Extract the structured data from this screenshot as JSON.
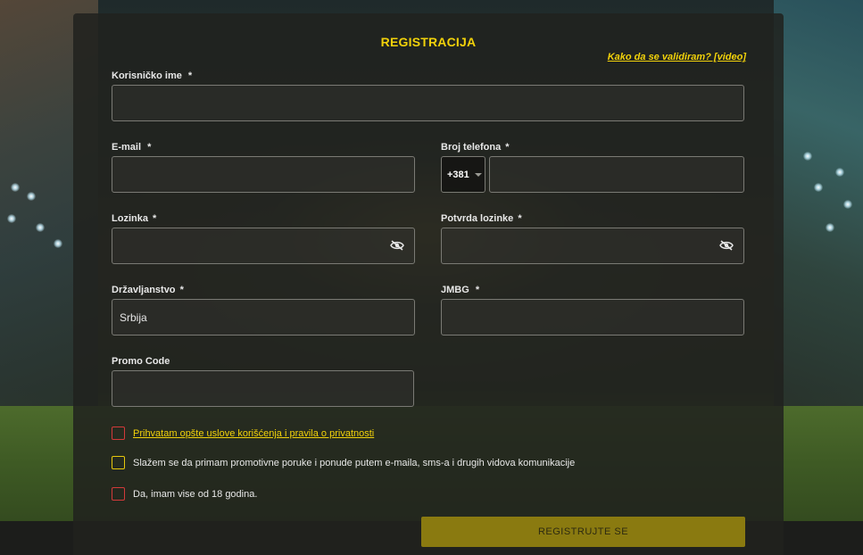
{
  "title": "REGISTRACIJA",
  "help_link": "Kako da se validiram? [video]",
  "fields": {
    "username": {
      "label": "Korisničko ime",
      "required": "*",
      "value": ""
    },
    "email": {
      "label": "E-mail",
      "required": "*",
      "value": ""
    },
    "phone": {
      "label": "Broj telefona",
      "required": "*",
      "prefix": "+381",
      "value": ""
    },
    "password": {
      "label": "Lozinka",
      "required": "*",
      "value": ""
    },
    "password_confirm": {
      "label": "Potvrda lozinke",
      "required": "*",
      "value": ""
    },
    "citizenship": {
      "label": "Državljanstvo",
      "required": "*",
      "value": "Srbija"
    },
    "jmbg": {
      "label": "JMBG",
      "required": "*",
      "value": ""
    },
    "promo": {
      "label": "Promo Code",
      "value": ""
    }
  },
  "checkboxes": {
    "terms": "Prihvatam opšte uslove korišćenja i pravila o privatnosti",
    "promo_messages": "Slažem se da primam promotivne poruke i ponude putem e-maila, sms-a i drugih vidova komunikacije",
    "age": "Da, imam vise od 18 godina."
  },
  "submit_label": "REGISTRUJTE SE",
  "icons": {
    "password_toggle": "eye-slash-icon",
    "phone_dropdown": "caret-down-icon"
  },
  "colors": {
    "accent": "#f2d20a",
    "button": "#8a7a10",
    "error_border": "#d23a3a"
  }
}
